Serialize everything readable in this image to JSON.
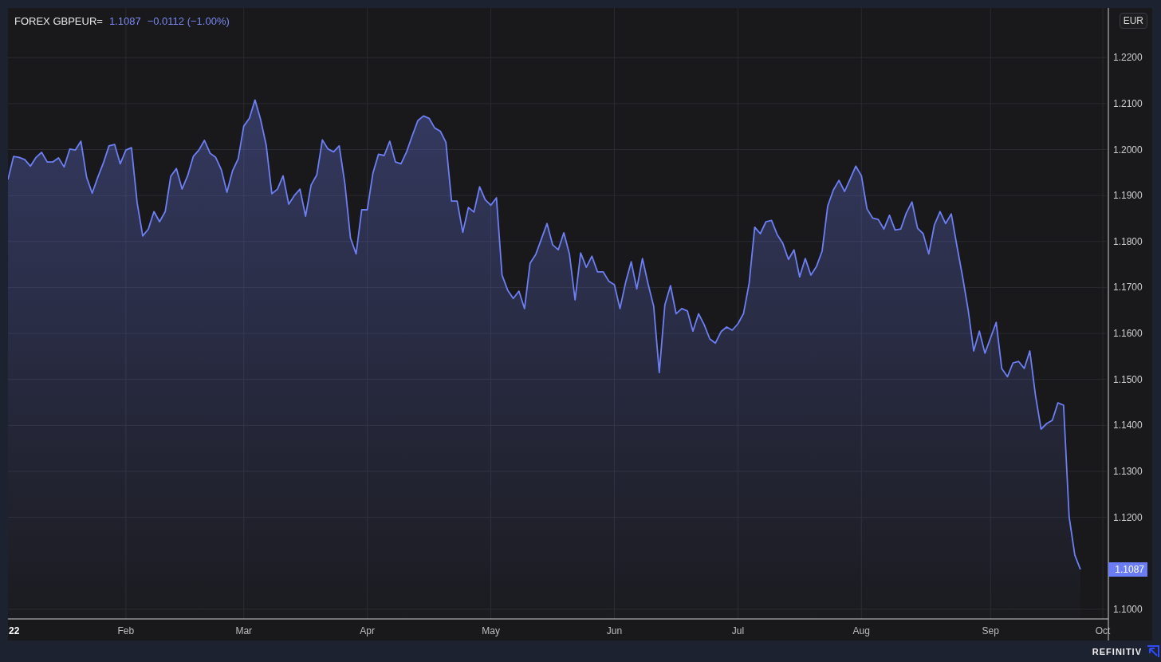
{
  "legend": {
    "price": "1.1087",
    "change": "−0.0112 (−1.00%)"
  },
  "currency_badge": "EUR",
  "price_badge": "1.1087",
  "x_axis_year_label": "22",
  "chart_data": {
    "type": "area",
    "grid": true,
    "ylim": [
      1.0979,
      1.2308
    ],
    "categories": [
      null,
      null,
      null,
      null,
      null,
      null,
      null,
      null,
      null,
      null,
      null,
      null,
      null,
      null,
      null,
      null,
      null,
      null,
      null,
      null,
      null,
      "Feb",
      null,
      null,
      null,
      null,
      null,
      null,
      null,
      null,
      null,
      null,
      null,
      null,
      null,
      null,
      null,
      null,
      null,
      null,
      null,
      null,
      "Mar",
      null,
      null,
      null,
      null,
      null,
      null,
      null,
      null,
      null,
      null,
      null,
      null,
      null,
      null,
      null,
      null,
      null,
      null,
      null,
      null,
      null,
      "Apr",
      null,
      null,
      null,
      null,
      null,
      null,
      null,
      null,
      null,
      null,
      null,
      null,
      null,
      null,
      null,
      null,
      null,
      null,
      null,
      null,
      null,
      "May",
      null,
      null,
      null,
      null,
      null,
      null,
      null,
      null,
      null,
      null,
      null,
      null,
      null,
      null,
      null,
      null,
      null,
      null,
      null,
      null,
      null,
      "Jun",
      null,
      null,
      null,
      null,
      null,
      null,
      null,
      null,
      null,
      null,
      null,
      null,
      null,
      null,
      null,
      null,
      null,
      null,
      null,
      null,
      null,
      "Jul",
      null,
      null,
      null,
      null,
      null,
      null,
      null,
      null,
      null,
      null,
      null,
      null,
      null,
      null,
      null,
      null,
      null,
      null,
      null,
      null,
      null,
      "Aug",
      null,
      null,
      null,
      null,
      null,
      null,
      null,
      null,
      null,
      null,
      null,
      null,
      null,
      null,
      null,
      null,
      null,
      null,
      null,
      null,
      null,
      null,
      "Sep",
      null,
      null,
      null,
      null,
      null,
      null,
      null,
      null,
      null,
      null,
      null,
      null,
      null,
      null,
      null,
      null,
      null,
      null,
      null,
      "Oct"
    ],
    "yticks": [
      {
        "value": 1.1,
        "label": "1.1000"
      },
      {
        "value": 1.12,
        "label": "1.1200"
      },
      {
        "value": 1.13,
        "label": "1.1300"
      },
      {
        "value": 1.14,
        "label": "1.1400"
      },
      {
        "value": 1.15,
        "label": "1.1500"
      },
      {
        "value": 1.16,
        "label": "1.1600"
      },
      {
        "value": 1.17,
        "label": "1.1700"
      },
      {
        "value": 1.18,
        "label": "1.1800"
      },
      {
        "value": 1.19,
        "label": "1.1900"
      },
      {
        "value": 1.2,
        "label": "1.2000"
      },
      {
        "value": 1.21,
        "label": "1.2100"
      },
      {
        "value": 1.22,
        "label": "1.2200"
      }
    ],
    "series": [
      {
        "name": "FOREX GBPEUR=",
        "color": "#6d7ff5",
        "values": [
          1.1935,
          1.1985,
          1.1983,
          1.1978,
          1.1964,
          1.1983,
          1.1994,
          1.1973,
          1.1973,
          1.1982,
          1.1962,
          1.2001,
          1.1999,
          1.2018,
          1.194,
          1.1905,
          1.194,
          1.1971,
          1.2008,
          1.2011,
          1.1969,
          1.1999,
          1.2004,
          1.1884,
          1.1812,
          1.1827,
          1.1865,
          1.1843,
          1.1865,
          1.1942,
          1.1959,
          1.1914,
          1.1943,
          1.1985,
          1.1999,
          1.202,
          1.1992,
          1.1983,
          1.1956,
          1.1907,
          1.1954,
          1.198,
          1.2051,
          1.2068,
          1.2108,
          1.2065,
          1.2009,
          1.1904,
          1.1914,
          1.1943,
          1.1881,
          1.19,
          1.1914,
          1.1855,
          1.1923,
          1.1945,
          1.2021,
          1.2001,
          1.1995,
          1.2008,
          1.1926,
          1.1808,
          1.1773,
          1.1869,
          1.1869,
          1.1949,
          1.199,
          1.1987,
          1.2018,
          1.1973,
          1.1969,
          1.1995,
          1.203,
          1.2063,
          1.2073,
          1.2068,
          1.2047,
          1.204,
          1.2016,
          1.1888,
          1.1888,
          1.182,
          1.1874,
          1.1864,
          1.1919,
          1.1891,
          1.1879,
          1.1895,
          1.1727,
          1.1694,
          1.1676,
          1.1692,
          1.1654,
          1.1753,
          1.1772,
          1.1805,
          1.1839,
          1.1793,
          1.1782,
          1.1819,
          1.1773,
          1.1673,
          1.1775,
          1.1744,
          1.1768,
          1.1734,
          1.1734,
          1.1714,
          1.1706,
          1.1654,
          1.1711,
          1.1756,
          1.1697,
          1.1763,
          1.1708,
          1.1659,
          1.1515,
          1.1662,
          1.1704,
          1.1643,
          1.1654,
          1.1649,
          1.1605,
          1.1643,
          1.1619,
          1.1588,
          1.1579,
          1.1604,
          1.1614,
          1.1607,
          1.1621,
          1.1643,
          1.1709,
          1.1831,
          1.1817,
          1.1843,
          1.1846,
          1.1815,
          1.1796,
          1.1761,
          1.1782,
          1.1723,
          1.1763,
          1.1727,
          1.1746,
          1.1779,
          1.1877,
          1.1912,
          1.1933,
          1.1909,
          1.1936,
          1.1964,
          1.1943,
          1.1871,
          1.1851,
          1.1848,
          1.1827,
          1.1857,
          1.1825,
          1.1827,
          1.1862,
          1.1886,
          1.1829,
          1.1817,
          1.1773,
          1.1836,
          1.1865,
          1.1839,
          1.186,
          1.1791,
          1.1725,
          1.1652,
          1.1562,
          1.1605,
          1.1557,
          1.159,
          1.1624,
          1.1524,
          1.1506,
          1.1536,
          1.1539,
          1.1524,
          1.1562,
          1.1465,
          1.1392,
          1.1404,
          1.1411,
          1.1449,
          1.1444,
          1.1201,
          1.1118,
          1.1087,
          null,
          null,
          null,
          null
        ]
      }
    ]
  },
  "brand": "REFINITIV"
}
